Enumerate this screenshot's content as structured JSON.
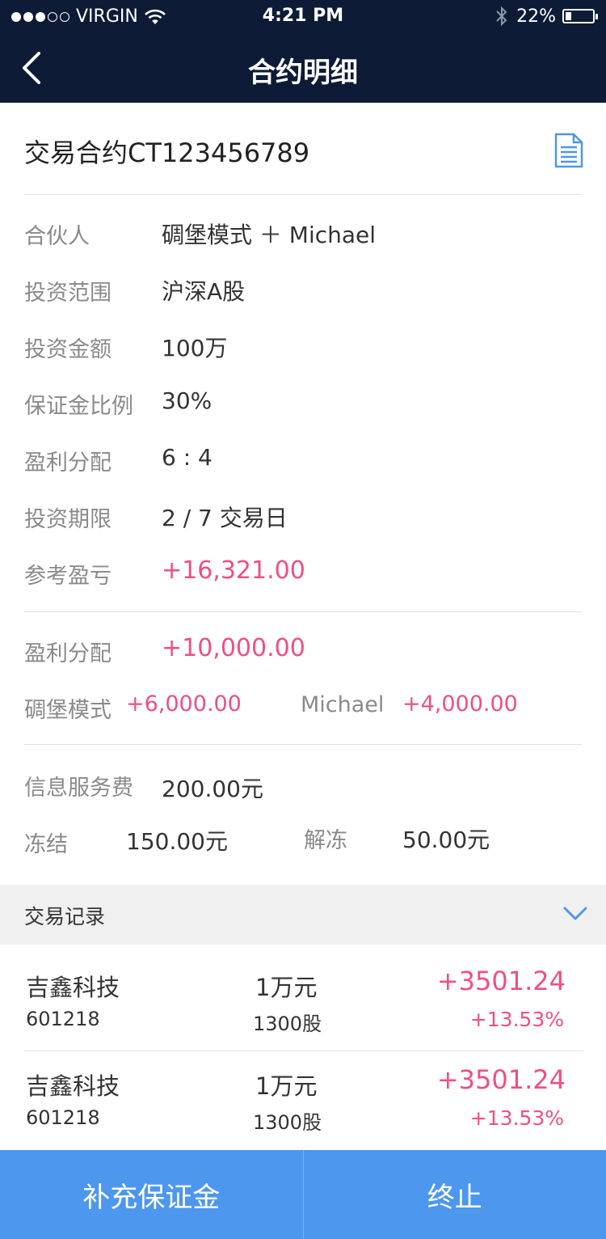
{
  "status_bar": {
    "carrier": "VIRGIN",
    "time": "4:21 PM",
    "battery": "22%",
    "battery_level": 0.22,
    "signal_bars_filled": 3,
    "signal_bars_total": 5
  },
  "nav": {
    "title": "合约明细",
    "back_icon": "chevron-left-icon"
  },
  "contract": {
    "title": "交易合约CT123456789",
    "doc_icon": "document-icon"
  },
  "details": {
    "partner_label": "合伙人",
    "partner_value": "碉堡模式 ＋ Michael",
    "scope_label": "投资范围",
    "scope_value": "沪深A股",
    "amount_label": "投资金额",
    "amount_value": "100万",
    "margin_label": "保证金比例",
    "margin_value": "30%",
    "split_label": "盈利分配",
    "split_value": "6 : 4",
    "term_label": "投资期限",
    "term_value": "2 / 7 交易日",
    "pnl_label": "参考盈亏",
    "pnl_value": "+16,321.00"
  },
  "distribution": {
    "label": "盈利分配",
    "total": "+10,000.00",
    "party_a_name": "碉堡模式",
    "party_a_amount": "+6,000.00",
    "party_b_name": "Michael",
    "party_b_amount": "+4,000.00"
  },
  "fees": {
    "service_label": "信息服务费",
    "service_value": "200.00元",
    "frozen_label": "冻结",
    "frozen_value": "150.00元",
    "unfrozen_label": "解冻",
    "unfrozen_value": "50.00元"
  },
  "records": {
    "label": "交易记录",
    "toggle_icon": "chevron-down-icon",
    "items": [
      {
        "name": "吉鑫科技",
        "code": "601218",
        "amount": "1万元",
        "shares": "1300股",
        "profit": "+3501.24",
        "pct": "+13.53%"
      },
      {
        "name": "吉鑫科技",
        "code": "601218",
        "amount": "1万元",
        "shares": "1300股",
        "profit": "+3501.24",
        "pct": "+13.53%"
      }
    ]
  },
  "actions": {
    "add_margin": "补充保证金",
    "terminate": "终止"
  },
  "colors": {
    "header": "#0d1b36",
    "accent": "#4d97ee",
    "positive": "#ee4f86"
  }
}
